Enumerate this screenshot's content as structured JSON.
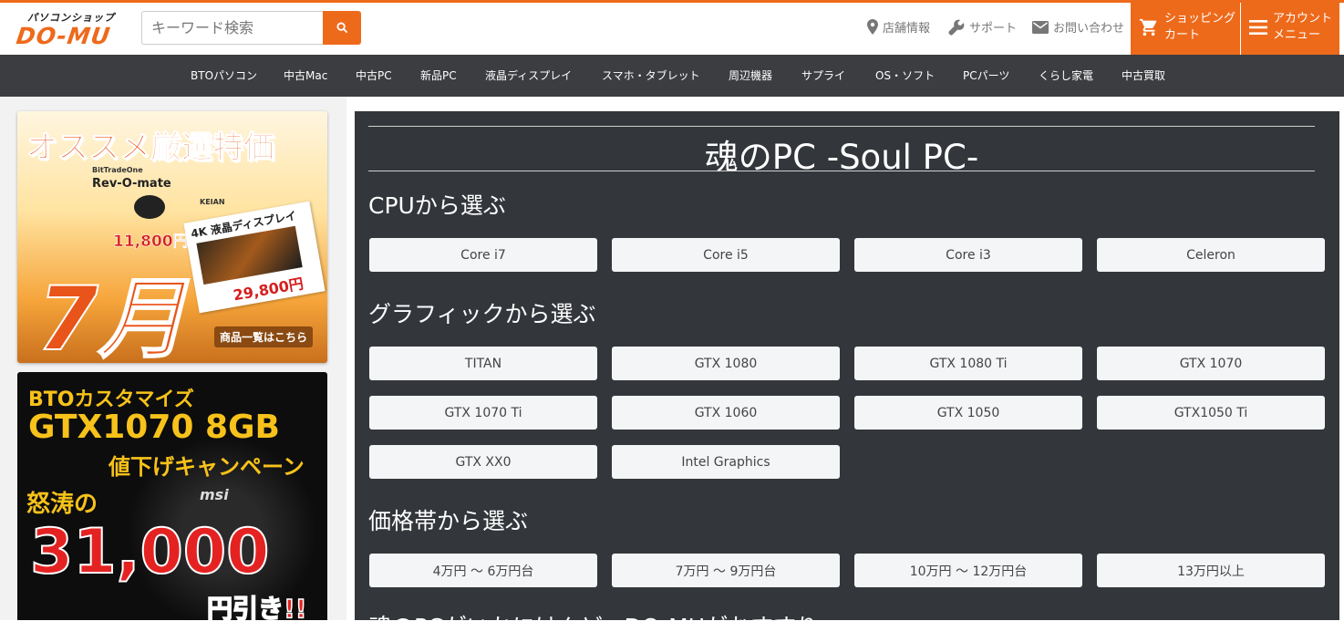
{
  "header": {
    "logo_top": "パソコンショップ",
    "logo_main": "DO-MU",
    "search_placeholder": "キーワード検索",
    "util": [
      {
        "icon": "map-pin-icon",
        "label": "店舗情報"
      },
      {
        "icon": "wrench-icon",
        "label": "サポート"
      },
      {
        "icon": "mail-icon",
        "label": "お問い合わせ"
      }
    ],
    "cart_line1": "ショッピング",
    "cart_line2": "カート",
    "account_line1": "アカウント",
    "account_line2": "メニュー"
  },
  "nav": [
    "BTOパソコン",
    "中古Mac",
    "中古PC",
    "新品PC",
    "液晶ディスプレイ",
    "スマホ・タブレット",
    "周辺機器",
    "サプライ",
    "OS・ソフト",
    "PCパーツ",
    "くらし家電",
    "中古買取"
  ],
  "banner1": {
    "headline": "オススメ厳選特価",
    "brand": "BitTradeOne",
    "product1": "Rev-O-mate",
    "price1": "11,800円",
    "brand2": "KEIAN",
    "product2": "4K 液晶ディスプレイ",
    "price2": "29,800円",
    "month": "7月",
    "cta": "商品一覧はこちら"
  },
  "banner2": {
    "line1": "BTOカスタマイズ",
    "line2": "GTX1070 8GB",
    "line3": "値下げキャンペーン",
    "line4": "怒涛の",
    "amount": "31,000",
    "line5": "円引き!!",
    "brand": "msi"
  },
  "main": {
    "title": "魂のPC -Soul PC-",
    "sections": [
      {
        "heading": "CPUから選ぶ",
        "items": [
          "Core i7",
          "Core i5",
          "Core i3",
          "Celeron"
        ]
      },
      {
        "heading": "グラフィックから選ぶ",
        "items": [
          "TITAN",
          "GTX 1080",
          "GTX 1080 Ti",
          "GTX 1070",
          "GTX 1070 Ti",
          "GTX 1060",
          "GTX 1050",
          "GTX1050 Ti",
          "GTX XX0",
          "Intel Graphics"
        ]
      },
      {
        "heading": "価格帯から選ぶ",
        "items": [
          "4万円 〜 6万円台",
          "7万円 〜 9万円台",
          "10万円 〜 12万円台",
          "13万円以上"
        ]
      }
    ],
    "footer_partial": "魂のPCがいかにけんど、DO-MUがおすすり"
  },
  "colors": {
    "accent": "#ee6a1b",
    "nav_bg": "#3b3d40",
    "main_bg": "#33363b",
    "chip_bg": "#f4f5f7"
  }
}
